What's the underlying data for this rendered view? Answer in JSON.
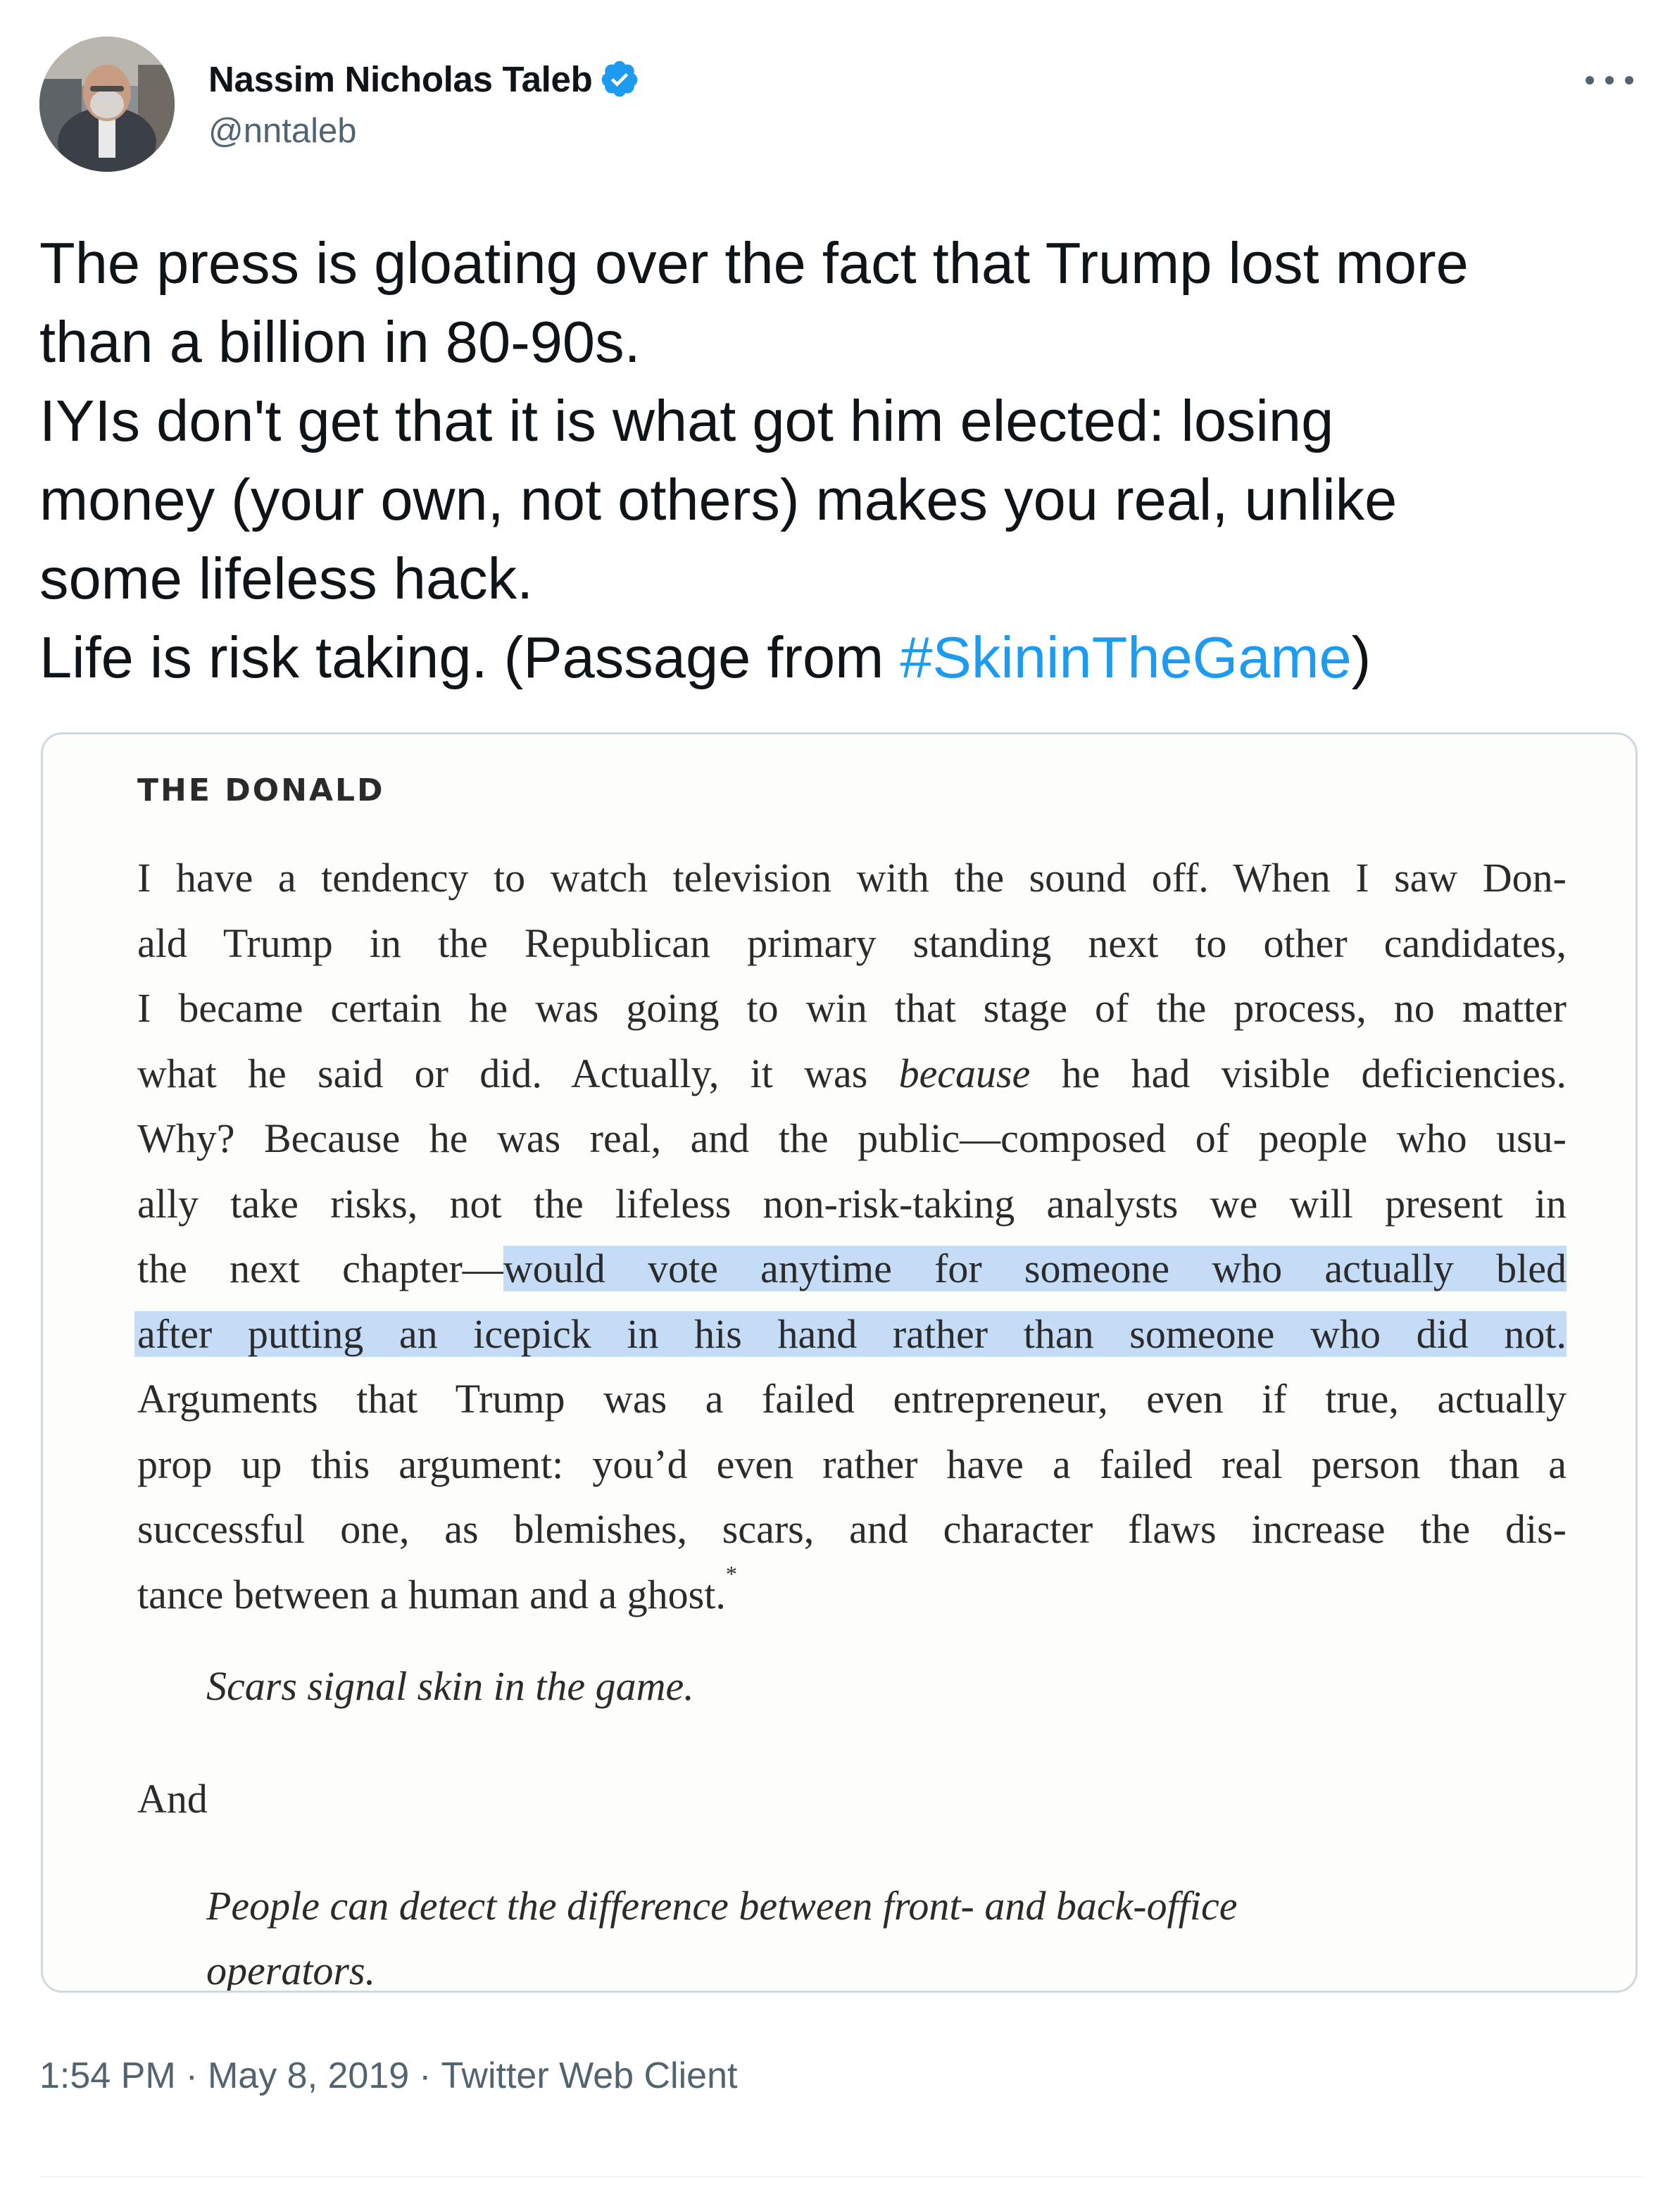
{
  "author": {
    "display_name": "Nassim Nicholas Taleb",
    "handle": "@nntaleb",
    "verified_icon": "verified-badge-icon",
    "verified_color": "#1d9bf0"
  },
  "more_icon": "more-horizontal-icon",
  "tweet": {
    "lines": [
      "The press is gloating over the fact that Trump lost more",
      "than a billion in 80-90s.",
      "IYIs don't get that it is what got him elected: losing",
      "money (your own, not others) makes you real, unlike",
      "some lifeless hack."
    ],
    "last_line_prefix": "Life is risk taking. (Passage from ",
    "hashtag": "#SkininTheGame",
    "last_line_suffix": ")",
    "hashtag_color": "#1d9bf0"
  },
  "book_page": {
    "heading": "THE DONALD",
    "lines": [
      "I have a tendency to watch television with the sound off. When I saw Don-",
      "ald Trump in the Republican primary standing next to other candidates,",
      "I became certain he was going to win that stage of the process, no matter",
      "what he said or did. Actually, it was because he had visible deficiencies.",
      "Why? Because he was real, and the public—composed of people who usu-",
      "ally take risks, not the lifeless non-risk-taking analysts we will present in"
    ],
    "line7_plain": "the next chapter—",
    "line7_highlight": "would vote anytime for someone who actually bled",
    "line8_highlight": "after putting an icepick in his hand rather than someone who did not.",
    "lines_after": [
      "Arguments that Trump was a failed entrepreneur, even if true, actually",
      "prop up this argument: you’d even rather have a failed real person than a",
      "successful one, as blemishes, scars, and character flaws increase the dis-"
    ],
    "last_line": "tance between a human and a ghost.",
    "footnote_mark": "*",
    "quote1": "Scars signal skin in the game.",
    "and_text": "And",
    "quote2_lines": [
      "People can detect the difference between front- and back-office",
      "operators."
    ],
    "highlight_color": "#c5dcf7"
  },
  "meta": {
    "time": "1:54 PM",
    "separator": "·",
    "date": "May 8, 2019",
    "client": "Twitter Web Client"
  }
}
